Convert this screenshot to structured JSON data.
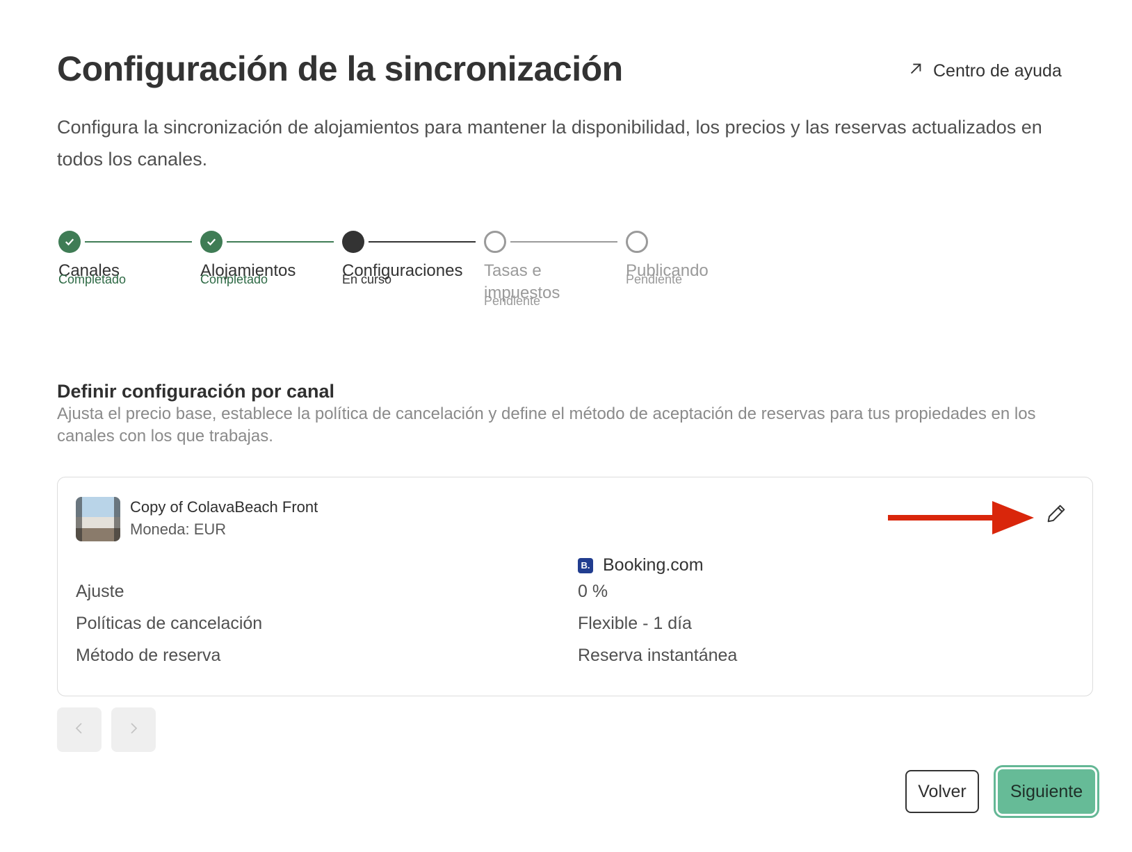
{
  "header": {
    "title": "Configuración de la sincronización",
    "help_link": "Centro de ayuda",
    "help_icon": "arrow-up-right-icon",
    "subtitle": "Configura la sincronización de alojamientos para mantener la disponibilidad, los precios y las reservas actualizados en todos los canales."
  },
  "stepper": {
    "steps": [
      {
        "label": "Canales",
        "status": "Completado",
        "state": "done"
      },
      {
        "label": "Alojamientos",
        "status": "Completado",
        "state": "done"
      },
      {
        "label": "Configuraciones",
        "status": "En curso",
        "state": "current"
      },
      {
        "label": "Tasas e impuestos",
        "status": "Pendiente",
        "state": "pending"
      },
      {
        "label": "Publicando",
        "status": "Pendiente",
        "state": "pending"
      }
    ]
  },
  "section": {
    "title": "Definir configuración por canal",
    "description": "Ajusta el precio base, establece la política de cancelación y define el método de aceptación de reservas para tus propiedades en los canales con los que trabajas."
  },
  "card": {
    "property_name": "Copy of ColavaBeach Front",
    "currency": "Moneda: EUR",
    "channel": {
      "logo_text": "B.",
      "name": "Booking.com"
    },
    "rows": [
      {
        "label": "Ajuste",
        "value": "0 %"
      },
      {
        "label": "Políticas de cancelación",
        "value": "Flexible - 1 día"
      },
      {
        "label": "Método de reserva",
        "value": "Reserva instantánea"
      }
    ],
    "edit_icon": "pencil-icon",
    "annotation_icon": "red-arrow-icon"
  },
  "pagination": {
    "prev_icon": "chevron-left-icon",
    "next_icon": "chevron-right-icon"
  },
  "footer": {
    "back_label": "Volver",
    "next_label": "Siguiente"
  },
  "colors": {
    "done": "#3f7c55",
    "current": "#333333",
    "pending": "#9a9a9a",
    "primary": "#66bb97",
    "arrow": "#d9260b",
    "booking": "#213d8f"
  }
}
